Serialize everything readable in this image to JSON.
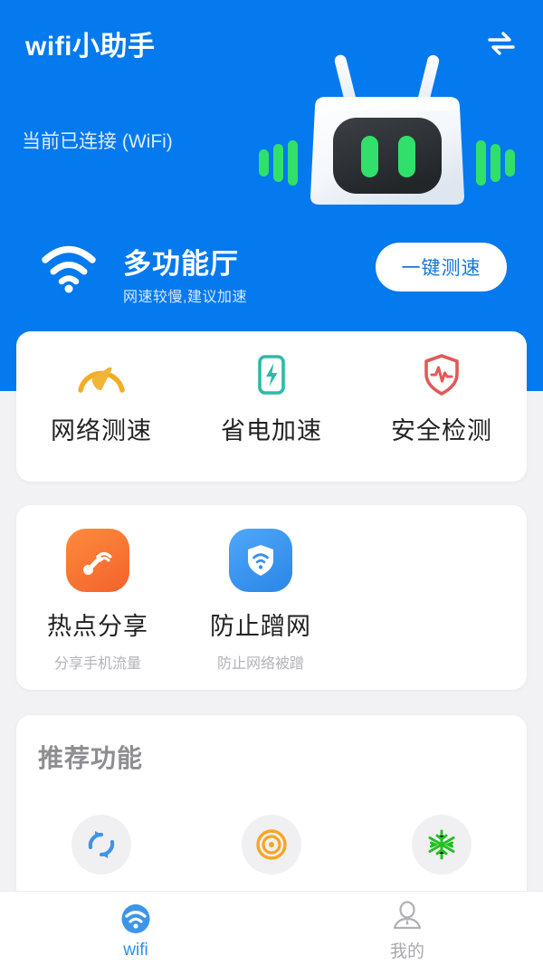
{
  "header": {
    "app_title": "wifi小助手",
    "swap_icon": "swap-arrows-icon",
    "status_text": "当前已连接 (WiFi)",
    "mascot_icon": "router-robot-illustration",
    "background_color": "#0579ee"
  },
  "multifunction": {
    "wifi_icon": "wifi-signal-icon",
    "title": "多功能厅",
    "subtitle": "网速较慢,建议加速",
    "button_label": "一键测速",
    "button_text_color": "#1476d8"
  },
  "quick_actions": {
    "items": [
      {
        "label": "网络测速",
        "icon": "speedometer-icon",
        "color": "#f2ad26"
      },
      {
        "label": "省电加速",
        "icon": "battery-bolt-icon",
        "color": "#2bbba8"
      },
      {
        "label": "安全检测",
        "icon": "shield-pulse-icon",
        "color": "#e05a57"
      }
    ]
  },
  "tools": {
    "items": [
      {
        "label": "热点分享",
        "sublabel": "分享手机流量",
        "icon": "hotspot-broadcast-icon",
        "color": "#f4622c"
      },
      {
        "label": "防止蹭网",
        "sublabel": "防止网络被蹭",
        "icon": "shield-wifi-icon",
        "color": "#2a85e8"
      }
    ]
  },
  "recommend": {
    "title": "推荐功能",
    "items": [
      {
        "icon": "sync-refresh-icon",
        "color": "#3d95e8"
      },
      {
        "icon": "target-radar-icon",
        "color": "#f5a623"
      },
      {
        "icon": "snowflake-icon",
        "color": "#22c022"
      }
    ]
  },
  "tabbar": {
    "tabs": [
      {
        "label": "wifi",
        "icon": "wifi-tab-icon",
        "active": true,
        "color": "#2c90ee"
      },
      {
        "label": "我的",
        "icon": "user-profile-icon",
        "active": false,
        "color": "#a8a8ad"
      }
    ]
  }
}
